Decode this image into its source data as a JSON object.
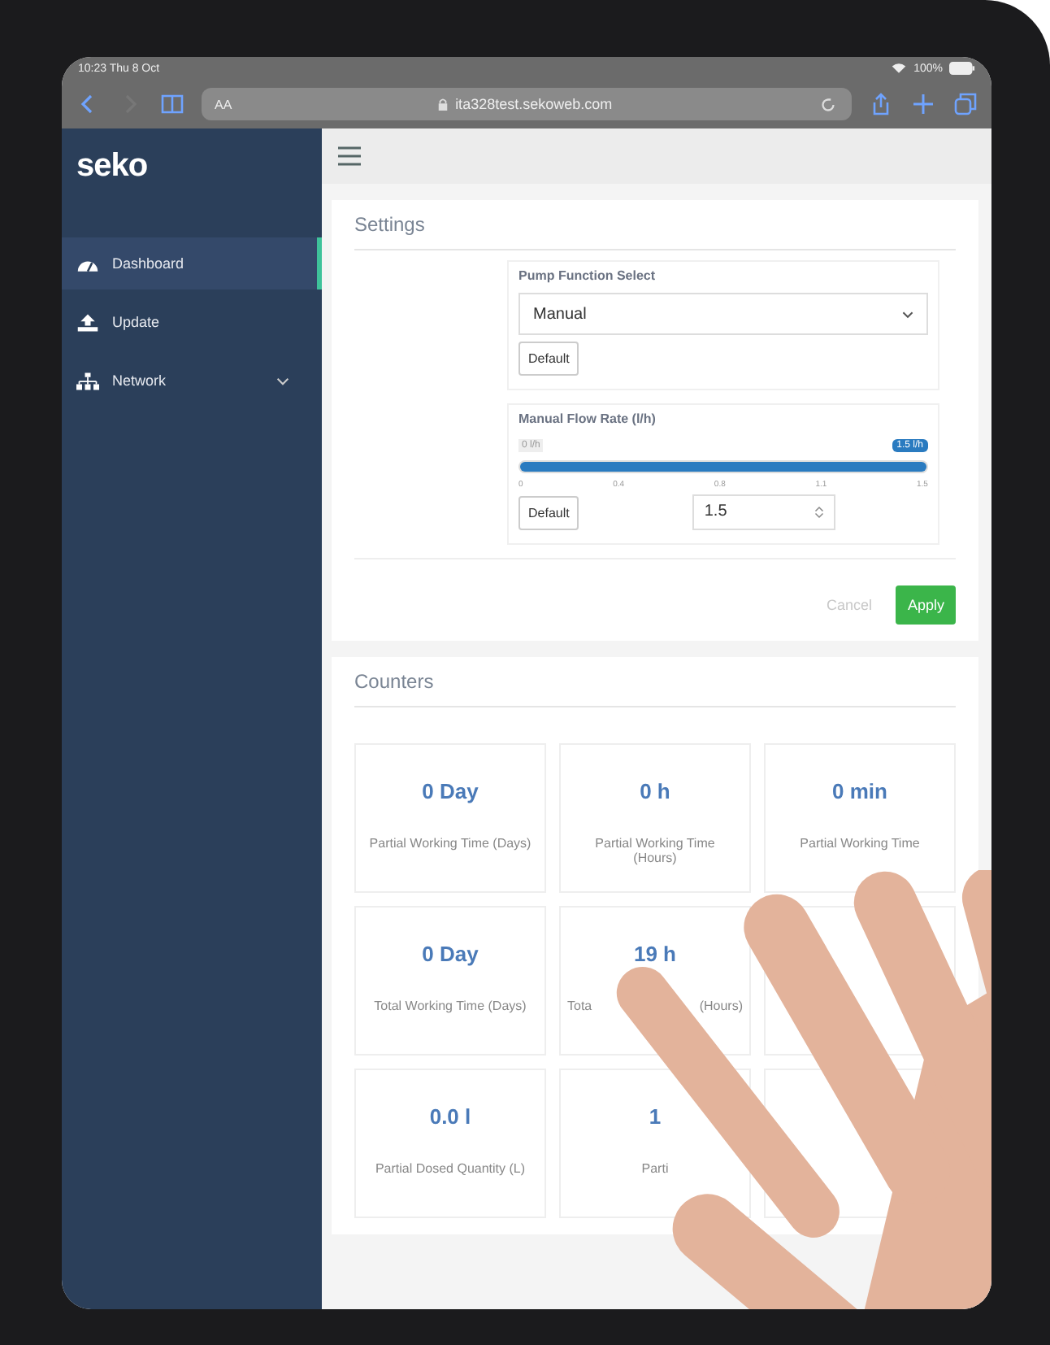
{
  "status_bar": {
    "time": "10:23  Thu 8 Oct",
    "battery": "100%"
  },
  "browser": {
    "text_size": "AA",
    "url": "ita328test.sekoweb.com"
  },
  "sidebar": {
    "logo": "seko",
    "items": [
      {
        "label": "Dashboard",
        "selected": true,
        "expandable": false
      },
      {
        "label": "Update",
        "selected": false,
        "expandable": false
      },
      {
        "label": "Network",
        "selected": false,
        "expandable": true
      }
    ]
  },
  "settings": {
    "title": "Settings",
    "pump_function": {
      "label": "Pump Function Select",
      "value": "Manual",
      "default_button": "Default"
    },
    "flow_rate": {
      "label": "Manual Flow Rate (l/h)",
      "min_label": "0 l/h",
      "value_bubble": "1.5 l/h",
      "level": 1.0,
      "ticks": [
        "0",
        "0.4",
        "0.8",
        "1.1",
        "1.5"
      ],
      "default_button": "Default",
      "value": "1.5"
    },
    "buttons": [
      {
        "label": "Cancel",
        "kind": "secondary"
      },
      {
        "label": "Apply",
        "kind": "primary"
      }
    ]
  },
  "counters": {
    "title": "Counters",
    "cards": [
      {
        "kind": "value",
        "value": "0 Day",
        "label": [
          "Partial Working Time (Days)"
        ]
      },
      {
        "kind": "value",
        "value": "0 h",
        "label": [
          "Partial Working Time",
          "(Hours)"
        ]
      },
      {
        "kind": "value",
        "value": "0 min",
        "label": [
          "Partial Working Time"
        ]
      },
      {
        "kind": "value",
        "value": "0 Day",
        "label": [
          "Total Working Time (Days)"
        ]
      },
      {
        "kind": "value",
        "value": "19 h",
        "label": [
          "Tota",
          "(Hours)"
        ]
      },
      {
        "kind": "covered"
      },
      {
        "kind": "value",
        "value": "0.0 l",
        "label": [
          "Partial Dosed Quantity (L)"
        ]
      },
      {
        "kind": "value",
        "value": "1",
        "label": [
          "Parti"
        ]
      },
      {
        "kind": "covered"
      }
    ]
  }
}
